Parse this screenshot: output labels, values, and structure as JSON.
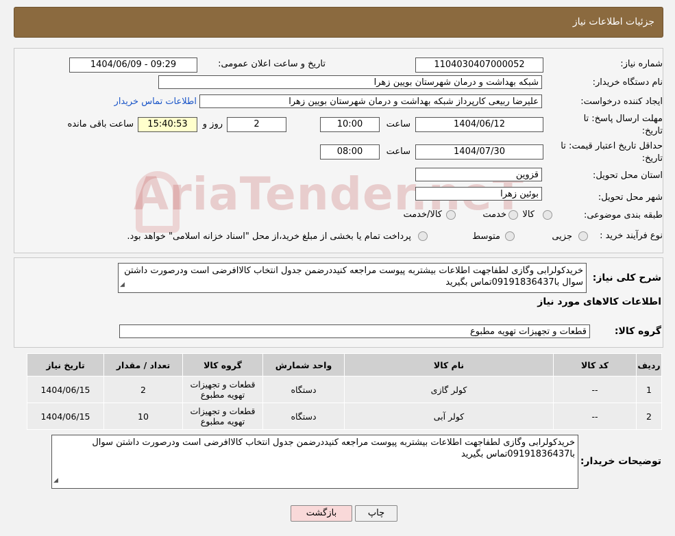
{
  "header": {
    "title": "جزئیات اطلاعات نیاز"
  },
  "form": {
    "need_number_label": "شماره نیاز:",
    "need_number": "1104030407000052",
    "announce_label": "تاریخ و ساعت اعلان عمومی:",
    "announce_value": "1404/06/09 - 09:29",
    "buyer_org_label": "نام دستگاه خریدار:",
    "buyer_org": "شبکه بهداشت و درمان شهرستان بویین زهرا",
    "requester_label": "ایجاد کننده درخواست:",
    "requester": "علیرضا ربیعی کارپرداز شبکه بهداشت و درمان شهرستان بویین زهرا",
    "contact_link": "اطلاعات تماس خریدار",
    "deadline_label_1": "مهلت ارسال پاسخ: تا",
    "deadline_label_2": "تاریخ:",
    "deadline_date": "1404/06/12",
    "time_label": "ساعت",
    "deadline_time": "10:00",
    "days_value": "2",
    "days_label": "روز و",
    "remaining_time": "15:40:53",
    "remaining_label": "ساعت باقی مانده",
    "validity_label_1": "حداقل تاریخ اعتبار قیمت: تا",
    "validity_label_2": "تاریخ:",
    "validity_date": "1404/07/30",
    "validity_time_label": "ساعت",
    "validity_time": "08:00",
    "province_label": "استان محل تحویل:",
    "province": "قزوین",
    "city_label": "شهر محل تحویل:",
    "city": "بوئین زهرا",
    "category_label": "طبقه بندی موضوعی:",
    "category_options": [
      "کالا",
      "خدمت",
      "کالا/خدمت"
    ],
    "process_label": "نوع فرآیند خرید :",
    "process_options": [
      "جزیی",
      "متوسط"
    ],
    "process_note": "پرداخت تمام یا بخشی از مبلغ خرید،از محل \"اسناد خزانه اسلامی\" خواهد بود."
  },
  "description": {
    "label": "شرح کلی نیاز:",
    "text": "خریدکولرابی وگازی لطفاجهت اطلاعات بیشتربه پیوست مراجعه کنیددرضمن جدول انتخاب کالاافرضی است ودرصورت داشتن سوال با09191836437تماس بگیرید"
  },
  "goods_section_title": "اطلاعات کالاهای مورد نیاز",
  "goods_group": {
    "label": "گروه کالا:",
    "value": "قطعات و تجهیزات تهویه مطبوع"
  },
  "table": {
    "headers": [
      "ردیف",
      "کد کالا",
      "نام کالا",
      "واحد شمارش",
      "گروه کالا",
      "تعداد / مقدار",
      "تاریخ نیاز"
    ],
    "rows": [
      [
        "1",
        "--",
        "کولر گازی",
        "دستگاه",
        "قطعات و تجهیزات تهویه مطبوع",
        "2",
        "1404/06/15"
      ],
      [
        "2",
        "--",
        "کولر آبی",
        "دستگاه",
        "قطعات و تجهیزات تهویه مطبوع",
        "10",
        "1404/06/15"
      ]
    ]
  },
  "buyer_notes": {
    "label": "توضیحات خریدار:",
    "text": "خریدکولرابی وگازی لطفاجهت اطلاعات بیشتربه پیوست مراجعه کنیددرضمن جدول انتخاب کالاافرضی است ودرصورت داشتن سوال با09191836437تماس بگیرید"
  },
  "buttons": {
    "print": "چاپ",
    "back": "بازگشت"
  },
  "watermark": "AriaTender.neT"
}
